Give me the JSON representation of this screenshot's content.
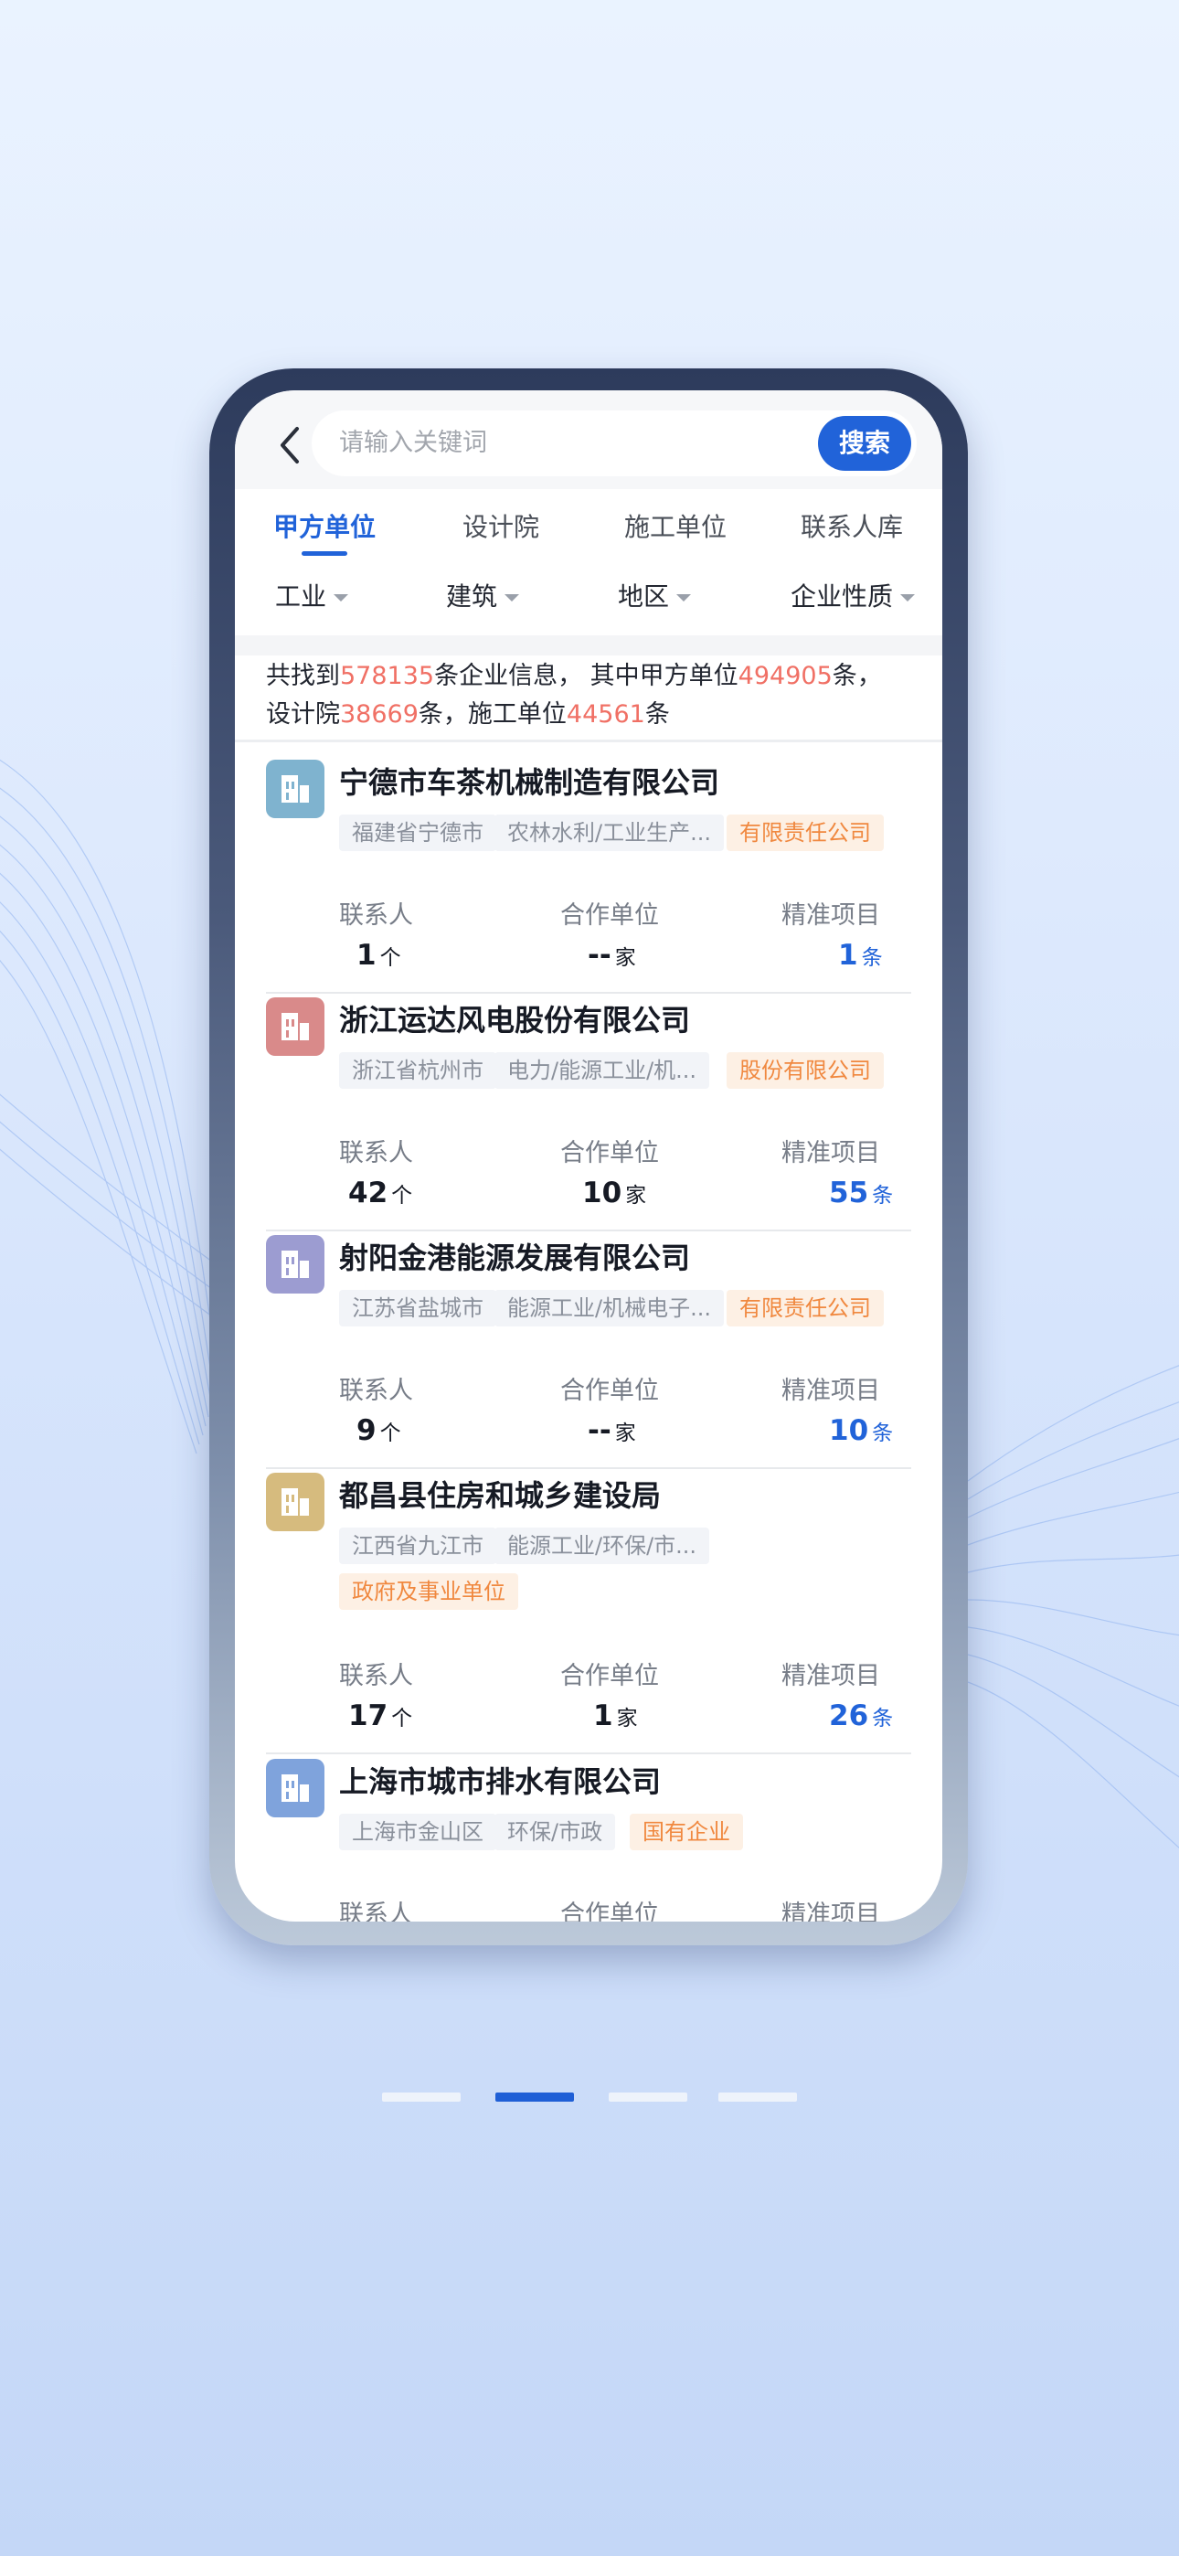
{
  "colors": {
    "accent": "#2163d9",
    "highlight": "#f07065",
    "tag_orange": "#f0883f"
  },
  "search": {
    "placeholder": "请输入关键词",
    "button_label": "搜索"
  },
  "tabs": [
    {
      "label": "甲方单位",
      "active": true
    },
    {
      "label": "设计院",
      "active": false
    },
    {
      "label": "施工单位",
      "active": false
    },
    {
      "label": "联系人库",
      "active": false
    }
  ],
  "filters": [
    "工业",
    "建筑",
    "地区",
    "企业性质"
  ],
  "summary": {
    "t1": "共找到",
    "total": "578135",
    "t2": "条企业信息， 其中甲方单位",
    "owner": "494905",
    "t3": "条，",
    "t4": "设计院",
    "design": "38669",
    "t5": "条，施工单位",
    "construct": "44561",
    "t6": "条"
  },
  "stat_labels": {
    "contacts": "联系人",
    "partners": "合作单位",
    "projects": "精准项目"
  },
  "units": {
    "contacts": "个",
    "partners": "家",
    "projects": "条"
  },
  "companies": [
    {
      "name": "宁德市车茶机械制造有限公司",
      "logo_color": "#7fb3cf",
      "tags": [
        "福建省宁德市",
        "农林水利/工业生产...",
        "有限责任公司"
      ],
      "contacts": "1",
      "partners": "--",
      "projects": "1"
    },
    {
      "name": "浙江运达风电股份有限公司",
      "logo_color": "#d98a8a",
      "tags": [
        "浙江省杭州市",
        "电力/能源工业/机...",
        "股份有限公司"
      ],
      "contacts": "42",
      "partners": "10",
      "projects": "55"
    },
    {
      "name": "射阳金港能源发展有限公司",
      "logo_color": "#9c9cd1",
      "tags": [
        "江苏省盐城市",
        "能源工业/机械电子...",
        "有限责任公司"
      ],
      "contacts": "9",
      "partners": "--",
      "projects": "10"
    },
    {
      "name": "都昌县住房和城乡建设局",
      "logo_color": "#d6bb7e",
      "tags": [
        "江西省九江市",
        "能源工业/环保/市...",
        "政府及事业单位"
      ],
      "contacts": "17",
      "partners": "1",
      "projects": "26"
    },
    {
      "name": "上海市城市排水有限公司",
      "logo_color": "#7fa3dc",
      "tags": [
        "上海市金山区",
        "环保/市政",
        "国有企业"
      ]
    }
  ],
  "pagination": {
    "count": 4,
    "active_index": 1
  }
}
